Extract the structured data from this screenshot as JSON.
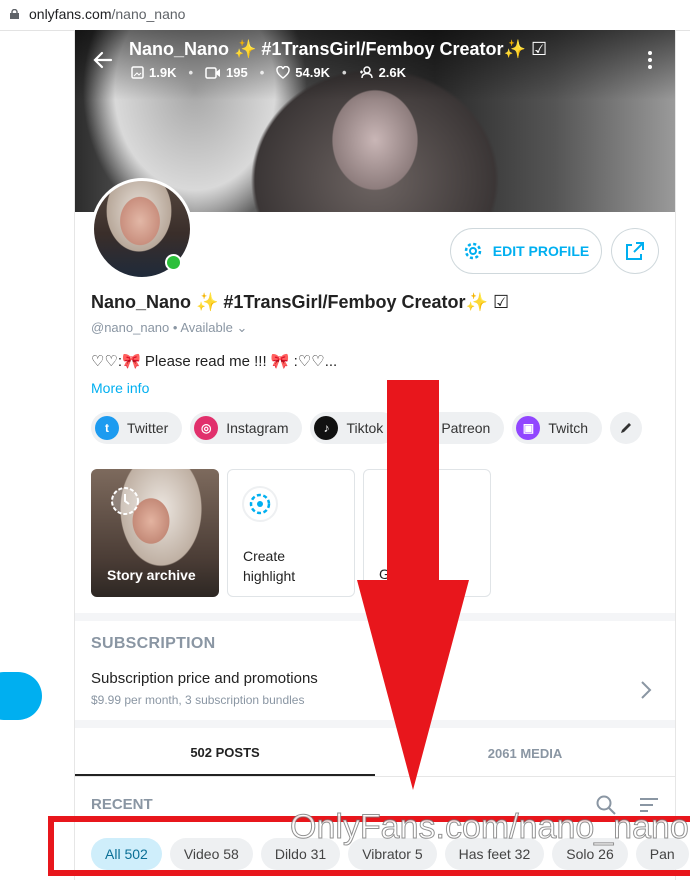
{
  "browser": {
    "url_domain": "onlyfans.com",
    "url_path": "/nano_nano"
  },
  "header": {
    "title": "Nano_Nano ✨ #1TransGirl/Femboy Creator✨",
    "stats": {
      "photos": "1.9K",
      "videos": "195",
      "likes": "54.9K",
      "fans": "2.6K"
    }
  },
  "profile": {
    "name": "Nano_Nano ✨ #1TransGirl/Femboy Creator✨",
    "handle": "@nano_nano",
    "status": "Available",
    "bio": "♡♡:🎀 Please read me !!! 🎀 :♡♡...",
    "more_info": "More info",
    "edit_label": "EDIT PROFILE"
  },
  "socials": [
    {
      "label": "Twitter",
      "color": "#1d9bf0"
    },
    {
      "label": "Instagram",
      "color": "#e1306c"
    },
    {
      "label": "Tiktok",
      "color": "#111111"
    },
    {
      "label": "Patreon",
      "color": "#ff424d"
    },
    {
      "label": "Twitch",
      "color": "#9146ff"
    }
  ],
  "highlights": {
    "archive": "Story archive",
    "create": "Create highlight",
    "third": "G"
  },
  "subscription": {
    "heading": "SUBSCRIPTION",
    "title": "Subscription price and promotions",
    "desc": "$9.99 per month, 3 subscription bundles"
  },
  "tabs": {
    "posts": "502 POSTS",
    "media": "2061 MEDIA"
  },
  "recent": "RECENT",
  "filters": [
    "All 502",
    "Video 58",
    "Dildo 31",
    "Vibrator 5",
    "Has feet 32",
    "Solo 26",
    "Pan"
  ],
  "watermark": "OnlyFans.com/nano_nano",
  "colors": {
    "accent": "#00aff0",
    "annotation_red": "#e8161c"
  }
}
